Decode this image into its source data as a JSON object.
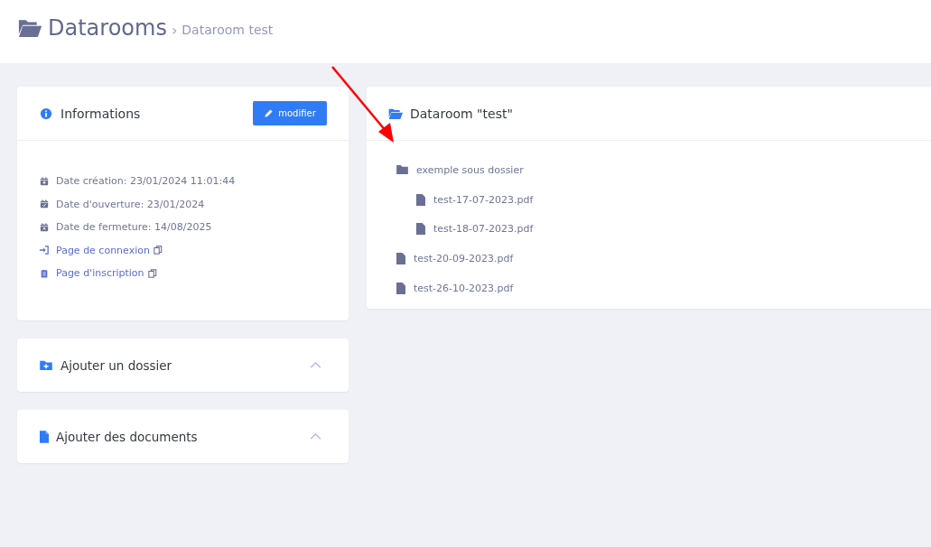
{
  "header": {
    "title": "Datarooms",
    "separator": "›",
    "breadcrumb": "Dataroom test"
  },
  "info_card": {
    "title": "Informations",
    "edit_button": "modifier",
    "items": [
      {
        "kind": "created",
        "text": "Date création: 23/01/2024 11:01:44"
      },
      {
        "kind": "opened",
        "text": "Date d'ouverture: 23/01/2024"
      },
      {
        "kind": "closed",
        "text": "Date de fermeture: 14/08/2025"
      },
      {
        "kind": "login",
        "text": "Page de connexion"
      },
      {
        "kind": "signup",
        "text": "Page d'inscription"
      }
    ]
  },
  "panels": [
    {
      "kind": "folder",
      "title": "Ajouter un dossier",
      "expanded": false
    },
    {
      "kind": "document",
      "title": "Ajouter des documents",
      "expanded": false
    }
  ],
  "dataroom": {
    "title": "Dataroom \"test\"",
    "tree": [
      {
        "kind": "folder",
        "name": "exemple sous dossier",
        "children": [
          {
            "kind": "file",
            "name": "test-17-07-2023.pdf"
          },
          {
            "kind": "file",
            "name": "test-18-07-2023.pdf"
          }
        ]
      },
      {
        "kind": "file",
        "name": "test-20-09-2023.pdf"
      },
      {
        "kind": "file",
        "name": "test-26-10-2023.pdf"
      }
    ]
  }
}
